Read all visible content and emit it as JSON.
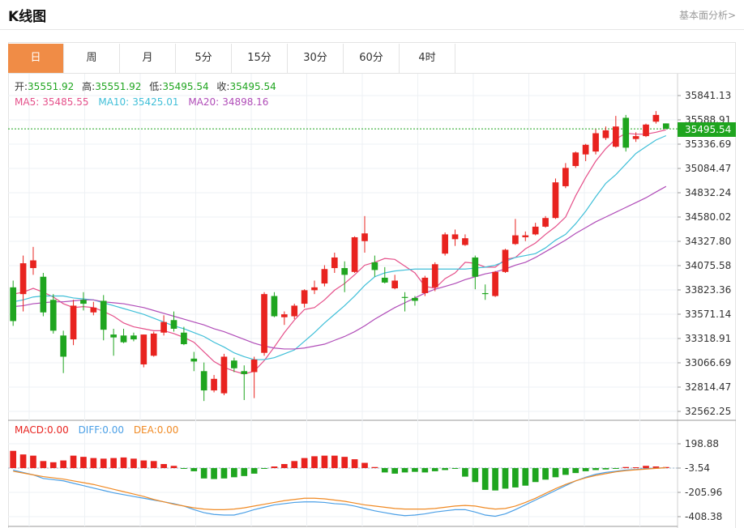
{
  "header": {
    "title": "K线图",
    "fundamental_link": "基本面分析>"
  },
  "tabs": [
    {
      "label": "日",
      "active": true
    },
    {
      "label": "周",
      "active": false
    },
    {
      "label": "月",
      "active": false
    },
    {
      "label": "5分",
      "active": false
    },
    {
      "label": "15分",
      "active": false
    },
    {
      "label": "30分",
      "active": false
    },
    {
      "label": "60分",
      "active": false
    },
    {
      "label": "4时",
      "active": false
    }
  ],
  "ohlc_info": {
    "open_label": "开:",
    "open": "35551.92",
    "high_label": "高:",
    "high": "35551.92",
    "low_label": "低:",
    "low": "35495.54",
    "close_label": "收:",
    "close": "35495.54"
  },
  "ma_info": {
    "ma5_label": "MA5:",
    "ma5": "35485.55",
    "ma10_label": "MA10:",
    "ma10": "35425.01",
    "ma20_label": "MA20:",
    "ma20": "34898.16"
  },
  "macd_info": {
    "macd_label": "MACD:",
    "macd": "0.00",
    "diff_label": "DIFF:",
    "diff": "0.00",
    "dea_label": "DEA:",
    "dea": "0.00"
  },
  "colors": {
    "up": "#e8231f",
    "down": "#1fa51f",
    "ma5": "#e5508a",
    "ma10": "#3fbfd8",
    "ma20": "#b04cb8",
    "diff": "#4a9fe6",
    "dea": "#f08a24",
    "tab_active": "#f08c46"
  },
  "chart_data": {
    "type": "candlestick",
    "price_axis_ticks": [
      "35841.13",
      "35588.91",
      "35336.69",
      "35084.47",
      "34832.24",
      "34580.02",
      "34327.80",
      "34075.58",
      "33823.36",
      "33571.14",
      "33318.91",
      "33066.69",
      "32814.47",
      "32562.25"
    ],
    "price_ylim": [
      32562.25,
      35841.13
    ],
    "current_price": "35495.54",
    "macd_axis_ticks": [
      "198.88",
      "-3.54",
      "-205.96",
      "-408.38"
    ],
    "macd_ylim": [
      -408.38,
      198.88
    ],
    "candles": [
      {
        "o": 33850,
        "h": 33920,
        "l": 33450,
        "c": 33500
      },
      {
        "o": 33780,
        "h": 34180,
        "l": 33600,
        "c": 34100
      },
      {
        "o": 34050,
        "h": 34270,
        "l": 33980,
        "c": 34130
      },
      {
        "o": 33960,
        "h": 34000,
        "l": 33550,
        "c": 33590
      },
      {
        "o": 33720,
        "h": 33780,
        "l": 33370,
        "c": 33400
      },
      {
        "o": 33350,
        "h": 33400,
        "l": 32960,
        "c": 33130
      },
      {
        "o": 33310,
        "h": 33720,
        "l": 33250,
        "c": 33660
      },
      {
        "o": 33720,
        "h": 33800,
        "l": 33610,
        "c": 33680
      },
      {
        "o": 33590,
        "h": 33700,
        "l": 33560,
        "c": 33640
      },
      {
        "o": 33710,
        "h": 33770,
        "l": 33300,
        "c": 33410
      },
      {
        "o": 33360,
        "h": 33420,
        "l": 33140,
        "c": 33330
      },
      {
        "o": 33350,
        "h": 33420,
        "l": 33270,
        "c": 33280
      },
      {
        "o": 33350,
        "h": 33380,
        "l": 33290,
        "c": 33310
      },
      {
        "o": 33050,
        "h": 33360,
        "l": 33020,
        "c": 33360
      },
      {
        "o": 33140,
        "h": 33390,
        "l": 33130,
        "c": 33370
      },
      {
        "o": 33380,
        "h": 33560,
        "l": 33350,
        "c": 33490
      },
      {
        "o": 33510,
        "h": 33600,
        "l": 33390,
        "c": 33420
      },
      {
        "o": 33380,
        "h": 33440,
        "l": 33250,
        "c": 33260
      },
      {
        "o": 33110,
        "h": 33180,
        "l": 32980,
        "c": 33080
      },
      {
        "o": 32980,
        "h": 33070,
        "l": 32670,
        "c": 32780
      },
      {
        "o": 32780,
        "h": 32940,
        "l": 32760,
        "c": 32900
      },
      {
        "o": 32750,
        "h": 33160,
        "l": 32730,
        "c": 33130
      },
      {
        "o": 33090,
        "h": 33120,
        "l": 32970,
        "c": 33010
      },
      {
        "o": 32980,
        "h": 33040,
        "l": 32680,
        "c": 32950
      },
      {
        "o": 32970,
        "h": 33130,
        "l": 32700,
        "c": 33100
      },
      {
        "o": 33170,
        "h": 33800,
        "l": 33140,
        "c": 33780
      },
      {
        "o": 33760,
        "h": 33800,
        "l": 33540,
        "c": 33550
      },
      {
        "o": 33540,
        "h": 33600,
        "l": 33460,
        "c": 33570
      },
      {
        "o": 33550,
        "h": 33680,
        "l": 33520,
        "c": 33660
      },
      {
        "o": 33680,
        "h": 33830,
        "l": 33640,
        "c": 33820
      },
      {
        "o": 33820,
        "h": 33920,
        "l": 33780,
        "c": 33850
      },
      {
        "o": 33890,
        "h": 34080,
        "l": 33860,
        "c": 34040
      },
      {
        "o": 34050,
        "h": 34210,
        "l": 34000,
        "c": 34160
      },
      {
        "o": 34050,
        "h": 34120,
        "l": 33800,
        "c": 33980
      },
      {
        "o": 34010,
        "h": 34380,
        "l": 34000,
        "c": 34370
      },
      {
        "o": 34330,
        "h": 34590,
        "l": 34210,
        "c": 34410
      },
      {
        "o": 34110,
        "h": 34180,
        "l": 33960,
        "c": 34030
      },
      {
        "o": 33950,
        "h": 34060,
        "l": 33890,
        "c": 33900
      },
      {
        "o": 33840,
        "h": 33980,
        "l": 33830,
        "c": 33920
      },
      {
        "o": 33750,
        "h": 33800,
        "l": 33600,
        "c": 33740
      },
      {
        "o": 33740,
        "h": 33760,
        "l": 33660,
        "c": 33710
      },
      {
        "o": 33790,
        "h": 33970,
        "l": 33760,
        "c": 33950
      },
      {
        "o": 33850,
        "h": 34110,
        "l": 33810,
        "c": 34090
      },
      {
        "o": 34200,
        "h": 34420,
        "l": 34180,
        "c": 34400
      },
      {
        "o": 34350,
        "h": 34450,
        "l": 34280,
        "c": 34400
      },
      {
        "o": 34290,
        "h": 34400,
        "l": 34280,
        "c": 34360
      },
      {
        "o": 34160,
        "h": 34180,
        "l": 33830,
        "c": 33960
      },
      {
        "o": 33790,
        "h": 33880,
        "l": 33720,
        "c": 33780
      },
      {
        "o": 33760,
        "h": 34020,
        "l": 33750,
        "c": 34010
      },
      {
        "o": 34010,
        "h": 34250,
        "l": 34000,
        "c": 34240
      },
      {
        "o": 34300,
        "h": 34560,
        "l": 34290,
        "c": 34390
      },
      {
        "o": 34370,
        "h": 34430,
        "l": 34330,
        "c": 34390
      },
      {
        "o": 34400,
        "h": 34520,
        "l": 34390,
        "c": 34480
      },
      {
        "o": 34480,
        "h": 34590,
        "l": 34470,
        "c": 34570
      },
      {
        "o": 34570,
        "h": 34980,
        "l": 34560,
        "c": 34940
      },
      {
        "o": 34900,
        "h": 35140,
        "l": 34880,
        "c": 35090
      },
      {
        "o": 35110,
        "h": 35260,
        "l": 35090,
        "c": 35250
      },
      {
        "o": 35230,
        "h": 35340,
        "l": 35160,
        "c": 35330
      },
      {
        "o": 35260,
        "h": 35490,
        "l": 35230,
        "c": 35450
      },
      {
        "o": 35400,
        "h": 35520,
        "l": 35380,
        "c": 35480
      },
      {
        "o": 35310,
        "h": 35630,
        "l": 35300,
        "c": 35520
      },
      {
        "o": 35610,
        "h": 35640,
        "l": 35260,
        "c": 35300
      },
      {
        "o": 35390,
        "h": 35460,
        "l": 35360,
        "c": 35420
      },
      {
        "o": 35420,
        "h": 35550,
        "l": 35410,
        "c": 35540
      },
      {
        "o": 35570,
        "h": 35680,
        "l": 35550,
        "c": 35640
      },
      {
        "o": 35552,
        "h": 35552,
        "l": 35495,
        "c": 35496
      }
    ],
    "ma5": [
      33780,
      33800,
      33840,
      33800,
      33750,
      33680,
      33640,
      33650,
      33640,
      33600,
      33550,
      33480,
      33440,
      33420,
      33400,
      33400,
      33370,
      33330,
      33280,
      33180,
      33080,
      33020,
      32980,
      32950,
      32980,
      33090,
      33230,
      33380,
      33510,
      33620,
      33640,
      33720,
      33820,
      33890,
      33980,
      34080,
      34110,
      34150,
      34140,
      34070,
      34000,
      33860,
      33840,
      33940,
      34000,
      34110,
      34100,
      34060,
      34060,
      34140,
      34160,
      34250,
      34310,
      34400,
      34480,
      34580,
      34800,
      34990,
      35160,
      35290,
      35390,
      35450,
      35440,
      35440,
      35460,
      35486
    ],
    "ma10": [
      33700,
      33720,
      33750,
      33760,
      33760,
      33760,
      33740,
      33730,
      33720,
      33690,
      33660,
      33630,
      33600,
      33570,
      33530,
      33490,
      33450,
      33420,
      33380,
      33340,
      33280,
      33230,
      33170,
      33130,
      33100,
      33100,
      33120,
      33160,
      33200,
      33290,
      33380,
      33480,
      33570,
      33660,
      33760,
      33870,
      33960,
      34000,
      34020,
      34030,
      34040,
      34040,
      34040,
      34040,
      34040,
      34040,
      34050,
      34060,
      34080,
      34120,
      34160,
      34180,
      34200,
      34260,
      34340,
      34400,
      34510,
      34640,
      34790,
      34930,
      35020,
      35130,
      35240,
      35310,
      35380,
      35425
    ],
    "ma20": [
      33650,
      33660,
      33680,
      33690,
      33700,
      33700,
      33710,
      33720,
      33720,
      33700,
      33690,
      33680,
      33660,
      33640,
      33610,
      33580,
      33550,
      33520,
      33490,
      33460,
      33420,
      33390,
      33350,
      33310,
      33270,
      33240,
      33220,
      33210,
      33210,
      33220,
      33240,
      33260,
      33300,
      33340,
      33390,
      33450,
      33520,
      33580,
      33640,
      33690,
      33740,
      33790,
      33830,
      33860,
      33890,
      33930,
      33960,
      33990,
      34010,
      34040,
      34080,
      34110,
      34160,
      34220,
      34280,
      34340,
      34410,
      34470,
      34530,
      34580,
      34630,
      34680,
      34730,
      34780,
      34840,
      34898
    ],
    "macd_hist": [
      140,
      110,
      100,
      55,
      45,
      60,
      100,
      90,
      80,
      75,
      80,
      85,
      75,
      60,
      55,
      30,
      15,
      -5,
      -30,
      -90,
      -95,
      -90,
      -80,
      -70,
      -50,
      -10,
      10,
      30,
      55,
      80,
      95,
      100,
      100,
      90,
      70,
      40,
      5,
      -40,
      -50,
      -40,
      -35,
      -40,
      -30,
      -20,
      -10,
      -75,
      -120,
      -185,
      -190,
      -175,
      -165,
      -150,
      -120,
      -100,
      -80,
      -60,
      -45,
      -30,
      -20,
      -15,
      -5,
      5,
      3,
      15,
      10,
      5
    ],
    "diff": [
      -20,
      -40,
      -60,
      -90,
      -100,
      -110,
      -130,
      -150,
      -170,
      -190,
      -210,
      -225,
      -240,
      -255,
      -270,
      -285,
      -300,
      -320,
      -350,
      -375,
      -390,
      -395,
      -395,
      -375,
      -350,
      -330,
      -310,
      -300,
      -290,
      -285,
      -285,
      -290,
      -300,
      -305,
      -320,
      -340,
      -360,
      -375,
      -390,
      -400,
      -395,
      -385,
      -370,
      -360,
      -350,
      -350,
      -370,
      -395,
      -405,
      -385,
      -350,
      -310,
      -270,
      -230,
      -190,
      -150,
      -110,
      -80,
      -55,
      -40,
      -30,
      -20,
      -15,
      -8,
      -5,
      0
    ],
    "dea": [
      -30,
      -45,
      -60,
      -75,
      -85,
      -95,
      -110,
      -125,
      -140,
      -160,
      -180,
      -200,
      -220,
      -240,
      -265,
      -285,
      -305,
      -320,
      -335,
      -345,
      -350,
      -350,
      -345,
      -335,
      -320,
      -305,
      -290,
      -275,
      -265,
      -255,
      -255,
      -260,
      -270,
      -280,
      -295,
      -310,
      -320,
      -330,
      -340,
      -345,
      -345,
      -345,
      -340,
      -330,
      -320,
      -315,
      -320,
      -335,
      -345,
      -340,
      -320,
      -290,
      -255,
      -215,
      -175,
      -140,
      -110,
      -85,
      -65,
      -50,
      -35,
      -25,
      -18,
      -12,
      -6,
      0
    ]
  }
}
